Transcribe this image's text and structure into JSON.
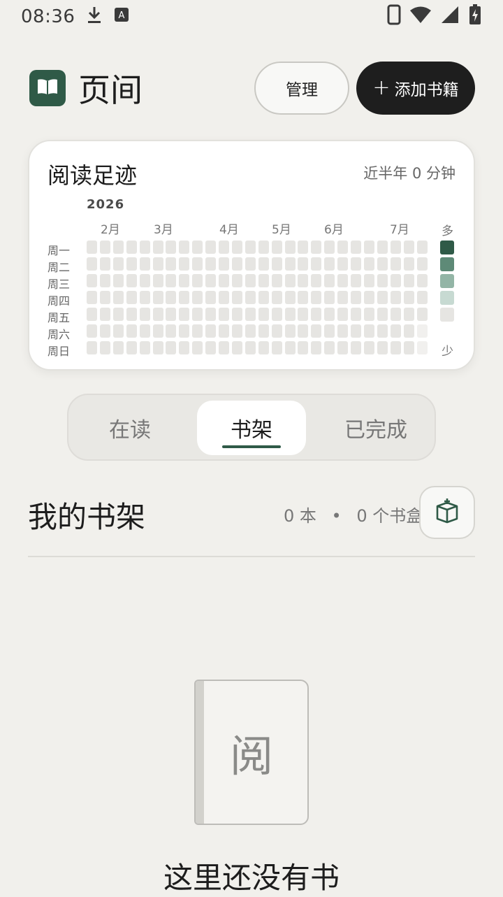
{
  "status_bar": {
    "time": "08:36"
  },
  "app": {
    "title": "页间",
    "icon": "open-book-icon"
  },
  "header": {
    "manage_label": "管理",
    "add_label": "添加书籍",
    "add_icon": "plus-icon"
  },
  "reading_card": {
    "title": "阅读足迹",
    "summary": "近半年 0 分钟",
    "year": "2026",
    "months": [
      "2月",
      "3月",
      "4月",
      "5月",
      "6月",
      "7月"
    ],
    "weekdays": [
      "周一",
      "周二",
      "周三",
      "周四",
      "周五",
      "周六",
      "周日"
    ],
    "legend_more": "多",
    "legend_less": "少",
    "legend_colors": [
      "#2f5a47",
      "#5e8a77",
      "#93b5a6",
      "#c7dad2",
      "#e6e5e2"
    ],
    "cell_empty_color": "#e6e5e2",
    "total_minutes": 0
  },
  "tabs": [
    {
      "label": "在读",
      "active": false
    },
    {
      "label": "书架",
      "active": true
    },
    {
      "label": "已完成",
      "active": false
    }
  ],
  "shelf": {
    "title": "我的书架",
    "book_count": "0 本",
    "separator": "•",
    "box_count": "0 个书盒",
    "box_icon": "book-box-icon"
  },
  "empty_state": {
    "book_glyph": "阅",
    "title": "这里还没有书"
  },
  "colors": {
    "accent": "#2f5a47",
    "background": "#f1f0ec",
    "primary_button": "#1e1e1e"
  }
}
